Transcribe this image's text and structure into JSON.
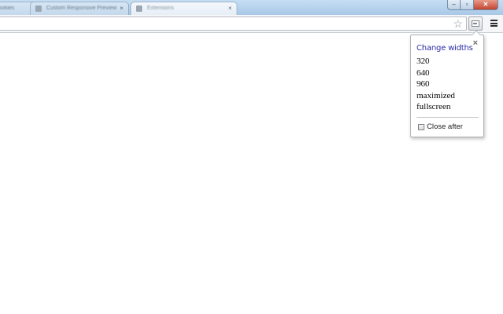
{
  "browser": {
    "tabs": [
      {
        "title": "Cookies",
        "close": "×",
        "active": false
      },
      {
        "title": "Custom Responsive Preview",
        "close": "×",
        "active": false
      },
      {
        "title": "Extensions",
        "close": "×",
        "active": true
      }
    ],
    "window_controls": {
      "minimize": "–",
      "maximize": "▫",
      "close": "✕"
    },
    "omnibox": {
      "value": ""
    },
    "toolbar_icons": {
      "star": "star-icon",
      "extension": "resize-extension-icon",
      "menu": "hamburger-menu-icon"
    }
  },
  "popup": {
    "close_glyph": "×",
    "heading": "Change widths",
    "width_options": [
      "320",
      "640",
      "960",
      "maximized",
      "fullscreen"
    ],
    "close_after_label": "Close after",
    "close_after_checked": false,
    "heading_color": "#2a2aa8"
  }
}
